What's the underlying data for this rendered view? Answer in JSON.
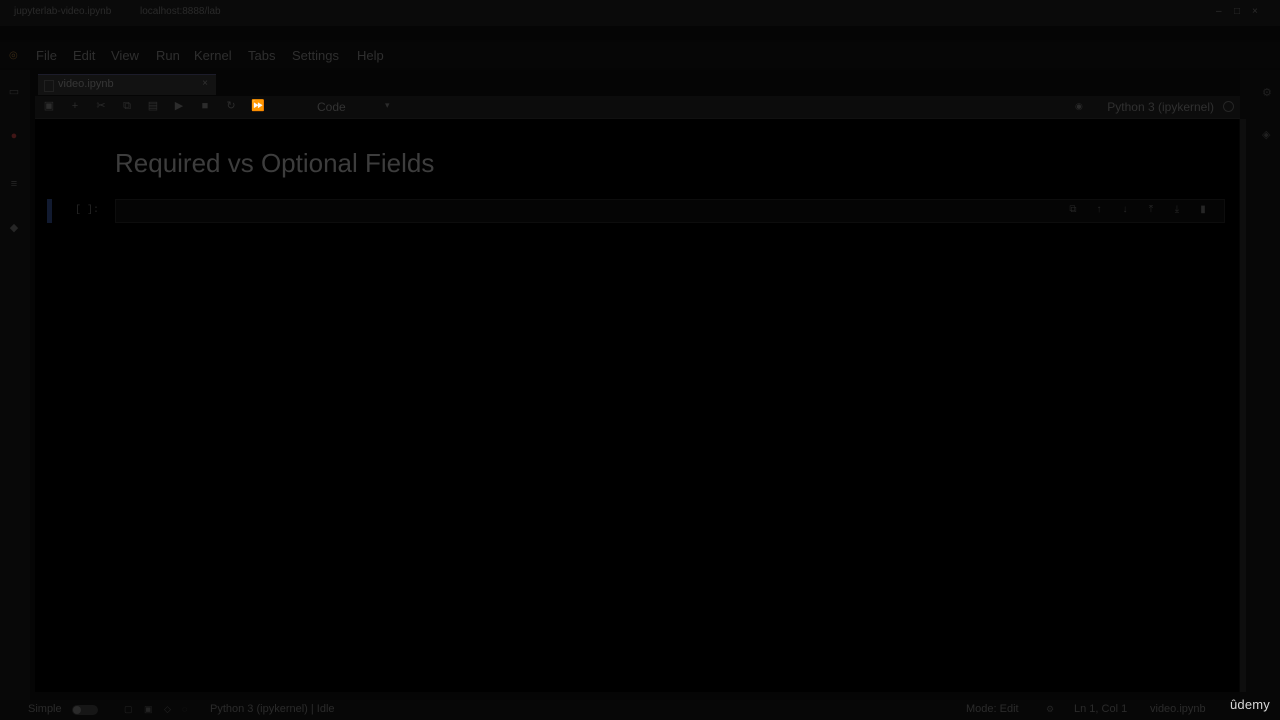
{
  "browser": {
    "tabs": [
      "jupyterlab-video.ipynb",
      "localhost:8888/lab"
    ],
    "controls": [
      "minimize-icon",
      "maximize-icon",
      "close-icon"
    ]
  },
  "menubar": {
    "items": [
      "File",
      "Edit",
      "View",
      "Run",
      "Kernel",
      "Tabs",
      "Settings",
      "Help"
    ]
  },
  "document": {
    "tab_name": "video.ipynb",
    "close_glyph": "×"
  },
  "toolbar": {
    "cell_type": "Code",
    "kernel": "Python 3 (ipykernel)"
  },
  "notebook": {
    "heading": "Required vs Optional Fields",
    "cell_prompt": "[ ]:"
  },
  "statusbar": {
    "mode_label": "Simple",
    "kernel_status": "Python 3 (ipykernel) | Idle",
    "mode": "Mode: Edit",
    "position": "Ln 1, Col 1",
    "file": "video.ipynb"
  },
  "watermark": "ûdemy",
  "colors": {
    "background": "#000000",
    "active_cell": "#111a30",
    "accent": "#401616"
  }
}
